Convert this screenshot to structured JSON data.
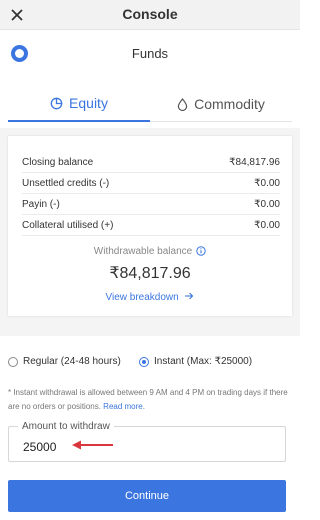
{
  "header": {
    "close_icon": "close-icon",
    "title": "Console"
  },
  "page": {
    "logo_icon": "ring-logo-icon",
    "title": "Funds"
  },
  "tabs": [
    {
      "label": "Equity",
      "icon": "pie-chart-icon",
      "active": true
    },
    {
      "label": "Commodity",
      "icon": "drop-icon",
      "active": false
    }
  ],
  "balances": [
    {
      "label": "Closing balance",
      "value": "₹84,817.96"
    },
    {
      "label": "Unsettled credits (-)",
      "value": "₹0.00"
    },
    {
      "label": "Payin (-)",
      "value": "₹0.00"
    },
    {
      "label": "Collateral utilised (+)",
      "value": "₹0.00"
    }
  ],
  "withdrawable": {
    "label": "Withdrawable balance",
    "info_icon": "info-icon",
    "value": "₹84,817.96",
    "breakdown_link": "View breakdown",
    "arrow_icon": "arrow-right-icon"
  },
  "withdrawal_mode": {
    "options": [
      {
        "label": "Regular (24-48 hours)",
        "selected": false
      },
      {
        "label": "Instant (Max: ₹25000)",
        "selected": true
      }
    ]
  },
  "note": {
    "text": "* Instant withdrawal is allowed between 9 AM and 4 PM on trading days if there are no orders or positions.",
    "link": "Read more."
  },
  "amount": {
    "label": "Amount to withdraw",
    "value": "25000"
  },
  "continue_label": "Continue",
  "colors": {
    "accent": "#3b76e0",
    "annotation_arrow": "#d9363e"
  }
}
